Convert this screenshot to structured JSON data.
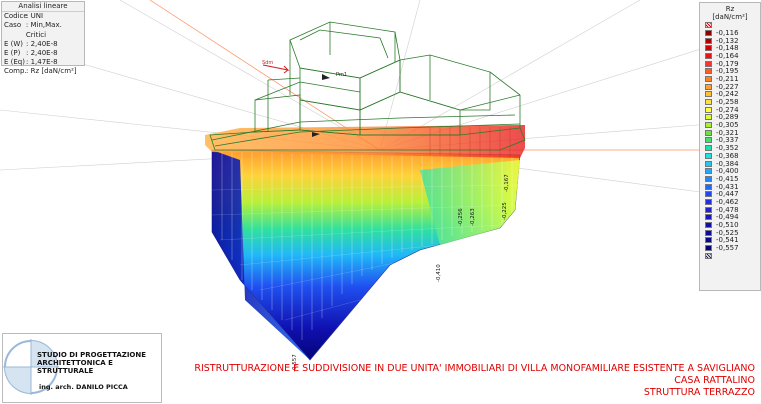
{
  "info_panel": {
    "title": "Analisi lineare",
    "rows": [
      {
        "k": "Codice",
        "v": ": UNI"
      },
      {
        "k": "Caso",
        "v": ": Min,Max. Critici"
      },
      {
        "k": "E (W)",
        "v": ": 2,40E-8"
      },
      {
        "k": "E (P)",
        "v": ": 2,40E-8"
      },
      {
        "k": "E (Eq)",
        "v": ": 1,47E-8"
      },
      {
        "k": "Comp.",
        "v": ": Rz [daN/cm²]"
      }
    ]
  },
  "legend": {
    "title": "Rz",
    "unit": "[daN/cm²]",
    "entries": [
      {
        "label": "-0,116",
        "color": "#8b0000"
      },
      {
        "label": "-0,132",
        "color": "#b00000"
      },
      {
        "label": "-0,148",
        "color": "#d40000"
      },
      {
        "label": "-0,164",
        "color": "#ee1010"
      },
      {
        "label": "-0,179",
        "color": "#ff3030"
      },
      {
        "label": "-0,195",
        "color": "#ff5a20"
      },
      {
        "label": "-0,211",
        "color": "#ff8020"
      },
      {
        "label": "-0,227",
        "color": "#ffa030"
      },
      {
        "label": "-0,242",
        "color": "#ffc030"
      },
      {
        "label": "-0,258",
        "color": "#ffe040"
      },
      {
        "label": "-0,274",
        "color": "#ffff40"
      },
      {
        "label": "-0,289",
        "color": "#d8ff30"
      },
      {
        "label": "-0,305",
        "color": "#a8f030"
      },
      {
        "label": "-0,321",
        "color": "#70e040"
      },
      {
        "label": "-0,337",
        "color": "#40e070"
      },
      {
        "label": "-0,352",
        "color": "#20e0a8"
      },
      {
        "label": "-0,368",
        "color": "#20e0e0"
      },
      {
        "label": "-0,384",
        "color": "#20c8f0"
      },
      {
        "label": "-0,400",
        "color": "#20a8ff"
      },
      {
        "label": "-0,415",
        "color": "#2088ff"
      },
      {
        "label": "-0,431",
        "color": "#2068ff"
      },
      {
        "label": "-0,447",
        "color": "#2048f0"
      },
      {
        "label": "-0,462",
        "color": "#2030e0"
      },
      {
        "label": "-0,478",
        "color": "#2020d0"
      },
      {
        "label": "-0,494",
        "color": "#1818c0"
      },
      {
        "label": "-0,510",
        "color": "#1010a8"
      },
      {
        "label": "-0,525",
        "color": "#0c0c98"
      },
      {
        "label": "-0,541",
        "color": "#080888"
      },
      {
        "label": "-0,557",
        "color": "#040478"
      }
    ],
    "top_icon": "hatch-swatch-icon",
    "bottom_icon": "hatch-swatch-icon"
  },
  "model_labels": {
    "values": [
      "-0,167",
      "-0,410",
      "-0,557",
      "-0,225",
      "-0,256",
      "-0,263"
    ],
    "marks": [
      "Sdm",
      "Pm1"
    ]
  },
  "studio": {
    "line1": "STUDIO DI PROGETTAZIONE",
    "line2": "ARCHITETTONICA E STRUTTURALE",
    "line3": "ing. arch. DANILO PICCA"
  },
  "project": {
    "line1": "RISTRUTTURAZIONE E SUDDIVISIONE IN DUE UNITA' IMMOBILIARI DI VILLA MONOFAMILIARE ESISTENTE A SAVIGLIANO",
    "line2": "CASA RATTALINO",
    "line3": "STRUTTURA TERRAZZO"
  },
  "colors": {
    "title_red": "#e00000",
    "frame_green": "#2a7a2a",
    "panel_bg": "#f2f2f2"
  }
}
